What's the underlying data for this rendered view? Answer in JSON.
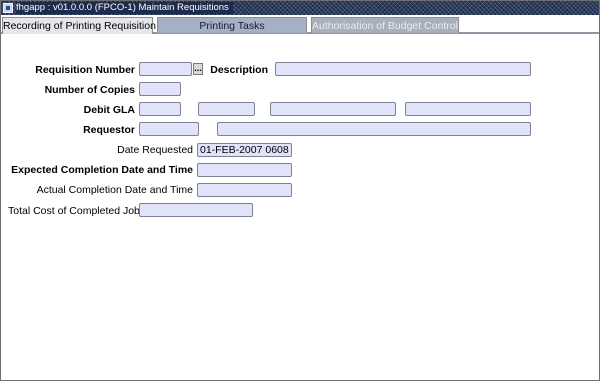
{
  "window": {
    "title": "fhgapp : v01.0.0.0 (FPCO-1) Maintain Requisitions"
  },
  "tabs": [
    {
      "label": "Recording of Printing Requisition",
      "state": "active"
    },
    {
      "label": "Printing Tasks",
      "state": "enabled"
    },
    {
      "label": "Authorisation of Budget Control",
      "state": "disabled"
    }
  ],
  "form": {
    "requisition_number_label": "Requisition Number",
    "requisition_number_value": "",
    "lov_button_label": "...",
    "description_label": "Description",
    "description_value": "",
    "number_of_copies_label": "Number of Copies",
    "number_of_copies_value": "",
    "debit_gla_label": "Debit GLA",
    "debit_gla_values": [
      "",
      "",
      "",
      ""
    ],
    "requestor_label": "Requestor",
    "requestor_code_value": "",
    "requestor_name_value": "",
    "date_requested_label": "Date Requested",
    "date_requested_value": "01-FEB-2007 0608",
    "expected_completion_label": "Expected Completion Date and Time",
    "expected_completion_value": "",
    "actual_completion_label": "Actual Completion Date and Time",
    "actual_completion_value": "",
    "total_cost_label": "Total Cost of Completed Jobs",
    "total_cost_value": ""
  },
  "colors": {
    "field_background": "#e1e3fb",
    "titlebar": "#1c2b4e",
    "tab_active": "#e4e6ea",
    "tab_inactive": "#a4b1c4"
  }
}
